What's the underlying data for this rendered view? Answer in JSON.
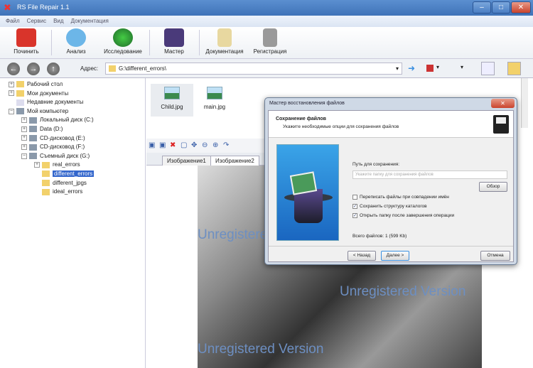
{
  "window": {
    "title": "RS File Repair 1.1",
    "minimize": "–",
    "maximize": "□",
    "close": "✕"
  },
  "menu": [
    "Файл",
    "Сервис",
    "Вид",
    "Документация"
  ],
  "toolbar": [
    {
      "label": "Починить",
      "icon": "repair-icon",
      "color": "#d9342b"
    },
    {
      "label": "Анализ",
      "icon": "magnifier-icon",
      "color": "#6cb6e8"
    },
    {
      "label": "Исследование",
      "icon": "radar-icon",
      "color": "#1f8a2a"
    },
    {
      "label": "Мастер",
      "icon": "wizard-hat-icon",
      "color": "#4a3a7a"
    },
    {
      "label": "Документация",
      "icon": "documentation-icon",
      "color": "#e8d8a0"
    },
    {
      "label": "Регистрация",
      "icon": "lock-icon",
      "color": "#9a9a9a"
    }
  ],
  "address": {
    "label": "Адрес:",
    "value": "G:\\different_errors\\"
  },
  "tree": [
    {
      "label": "Рабочий стол",
      "level": 0,
      "expander": "+",
      "type": "folder"
    },
    {
      "label": "Мои документы",
      "level": 0,
      "expander": "+",
      "type": "folder"
    },
    {
      "label": "Недавние документы",
      "level": 0,
      "expander": "",
      "type": "doc"
    },
    {
      "label": "Мой компьютер",
      "level": 0,
      "expander": "−",
      "type": "computer"
    },
    {
      "label": "Локальный диск (C:)",
      "level": 1,
      "expander": "+",
      "type": "drive"
    },
    {
      "label": "Data (D:)",
      "level": 1,
      "expander": "+",
      "type": "drive"
    },
    {
      "label": "CD-дисковод (E:)",
      "level": 1,
      "expander": "+",
      "type": "drive"
    },
    {
      "label": "CD-дисковод (F:)",
      "level": 1,
      "expander": "+",
      "type": "drive"
    },
    {
      "label": "Съемный диск (G:)",
      "level": 1,
      "expander": "−",
      "type": "drive"
    },
    {
      "label": "real_errors",
      "level": 2,
      "expander": "+",
      "type": "folder"
    },
    {
      "label": "different_errors",
      "level": 2,
      "expander": "",
      "type": "folder",
      "selected": true
    },
    {
      "label": "different_jpgs",
      "level": 2,
      "expander": "",
      "type": "folder"
    },
    {
      "label": "ideal_errors",
      "level": 2,
      "expander": "",
      "type": "folder"
    }
  ],
  "files": [
    "Child.jpg",
    "main.jpg"
  ],
  "image_tabs": [
    "Изображение1",
    "Изображение2"
  ],
  "watermark": "Unregistered Version",
  "dialog": {
    "title": "Мастер восстановления файлов",
    "heading": "Сохранение файлов",
    "subheading": "Укажите необходимые опции для сохранения файлов",
    "path_label": "Путь для сохранения:",
    "path_placeholder": "Укажите папку для сохранения файлов",
    "browse": "Обзор",
    "options": [
      {
        "label": "Переписать файлы при совпадении имён",
        "checked": false
      },
      {
        "label": "Сохранить структуру каталогов",
        "checked": true
      },
      {
        "label": "Открыть папку после завершения операции",
        "checked": true
      }
    ],
    "total": "Всего файлов: 1 (599 Kb)",
    "back": "< Назад",
    "next": "Далее >",
    "cancel": "Отмена"
  }
}
